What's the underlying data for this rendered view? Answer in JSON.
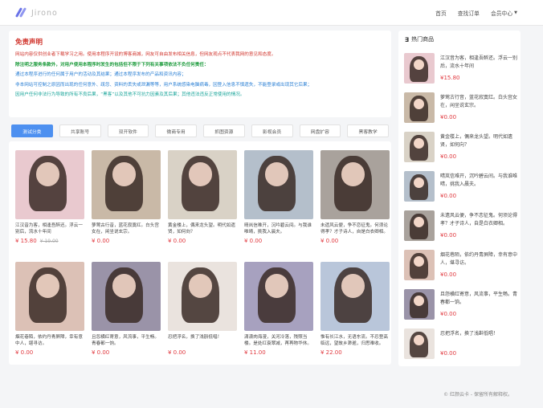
{
  "header": {
    "brand": "Jirono",
    "nav": [
      "首页",
      "查找订单",
      "会员中心"
    ]
  },
  "notice": {
    "title": "免责声明",
    "lines": [
      {
        "text": "网站内容仅供创业者下载学习之用。使用本程序开设的博客商城，网友可自由发布相关信息，但网友观点不代表我网的意见和态度。",
        "color": "#d0342c",
        "bold": false
      },
      {
        "text": "除注明之服务条款外，对用户使用本程序时发生的包括但不限于下列有关事项依法不负任何责任：",
        "color": "#1a9a3a",
        "bold": true
      },
      {
        "text": "通过本程序进行的任何属于用户的活动及其结果；通过本程序发布的产品和资讯内容；",
        "color": "#2a7fd4",
        "bold": false
      },
      {
        "text": "非本网站可控制之原因而出现的任何意外、疏忽、资料的丢失或泄漏等等，用户系统感染电脑病毒，因登入信息不慎遗失，不能登录或出现其它后果；",
        "color": "#2a7fd4",
        "bold": false
      },
      {
        "text": "因用户任何非法行为导致的所有不良后果，“黑客”以及其他不可抗力因素及其后果；其他违法违反正常使用的情况。",
        "color": "#1aa59a",
        "bold": false
      }
    ]
  },
  "tabs": [
    "测试分类",
    "共享账号",
    "双开软件",
    "微商专用",
    "抓图资源",
    "影视会员",
    "网盘扩容",
    "黑客教学"
  ],
  "products": [
    {
      "title": "江汉音为客，相逢吾醉还。浮云一别后，流水十年间",
      "price": "¥ 15.80",
      "old": "¥ 19.00",
      "bg": "#e9c9cf"
    },
    {
      "title": "萝莺古行音，蓝花寂寞红。白头宫女在，闲坐说玄宗。",
      "price": "¥ 0.00",
      "old": "",
      "bg": "#c9b9a7"
    },
    {
      "title": "黄金楼上，偶来龙头望。明代如遗贤，如何向？",
      "price": "¥ 0.00",
      "old": "",
      "bg": "#d9d2c6"
    },
    {
      "title": "晴岚信难开，沉吟碧云间。与我谁唯晴，挑我入晨夫。",
      "price": "¥ 0.00",
      "old": "",
      "bg": "#b4bfcb"
    },
    {
      "title": "未遗风云便，争不恋征鬼。何须论得孝？才子诗人，自是白衣卿相。",
      "price": "¥ 0.00",
      "old": "",
      "bg": "#a9a29c"
    },
    {
      "title": "烟花巷陌，依约丹青屏障，幸有意中人，堪寻访。",
      "price": "¥ 0.00",
      "old": "",
      "bg": "#dcc1b6"
    },
    {
      "title": "且怨横红寄意，风流事，平生畅。青春都一饷。",
      "price": "¥ 0.00",
      "old": "",
      "bg": "#9a93a8"
    },
    {
      "title": "忍把浮名，换了浅斟低唱！",
      "price": "¥ 0.00",
      "old": "",
      "bg": "#eae3de"
    },
    {
      "title": "潇潇肉海漫，关河冷落，残照当楼。是处红衰翠减，苒苒物华休。",
      "price": "¥ 11.00",
      "old": "",
      "bg": "#a7a1bf"
    },
    {
      "title": "惟有长江水，无语东流。不忍登高临远，望故乡渺邈，归思难收。",
      "price": "¥ 22.00",
      "old": "",
      "bg": "#b9c6da"
    }
  ],
  "hot": {
    "title": "热门商品",
    "items": [
      {
        "title": "江汉音为客，相逢吾醉还。浮云一别后，流水十年间",
        "price": "¥15.80",
        "bg": "#e9c9cf"
      },
      {
        "title": "萝莺古行音，蓝花寂寞红。白头宫女在，闲坐说玄宗。",
        "price": "¥0.00",
        "bg": "#c9b9a7"
      },
      {
        "title": "黄金楼上，偶来龙头望。明代如遗贤，如何向？",
        "price": "¥0.00",
        "bg": "#d9d2c6"
      },
      {
        "title": "晴岚信难开，沉吟碧云间。与我谁唯晴，挑我入晨夫。",
        "price": "¥0.00",
        "bg": "#b4bfcb"
      },
      {
        "title": "未遗风云便，争不恋征鬼。何须论得孝？才子诗人，自是白衣卿相。",
        "price": "¥0.00",
        "bg": "#a9a29c"
      },
      {
        "title": "烟花巷陌，依约丹青屏障，幸有意中人，堪寻访。",
        "price": "¥0.00",
        "bg": "#dcc1b6"
      },
      {
        "title": "且怨横红寄意，风流事，平生畅。青春都一饷。",
        "price": "¥0.00",
        "bg": "#9a93a8"
      },
      {
        "title": "忍把浮名，换了浅斟低唱！",
        "price": "¥0.00",
        "bg": "#eae3de"
      }
    ]
  },
  "footer": "© 红颜云卡 - 保留所有解释权。",
  "colors": {
    "accent": "#4d90f0",
    "price": "#e0383e",
    "notice_title": "#d0342c"
  }
}
